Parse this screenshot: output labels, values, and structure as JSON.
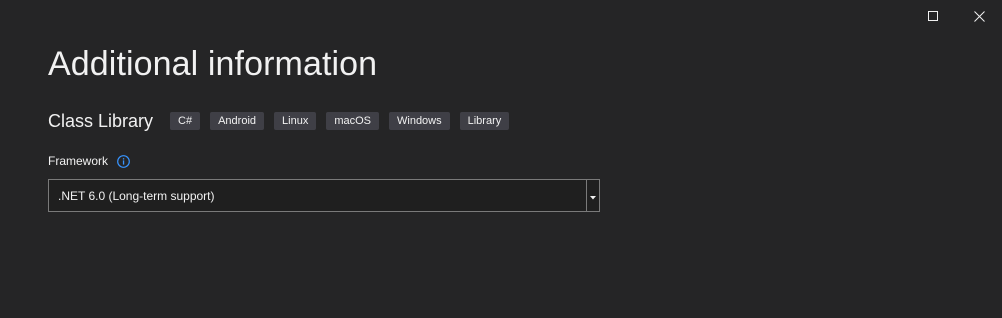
{
  "dialog": {
    "title": "Additional information"
  },
  "window_controls": {
    "maximize_icon": "maximize-icon",
    "close_icon": "close-icon"
  },
  "template": {
    "name": "Class Library",
    "tags": [
      "C#",
      "Android",
      "Linux",
      "macOS",
      "Windows",
      "Library"
    ]
  },
  "framework": {
    "label": "Framework",
    "info_icon": "info-icon",
    "selected": ".NET 6.0 (Long-term support)",
    "dropdown_icon": "caret-down-icon"
  },
  "colors": {
    "background": "#252526",
    "text": "#f1f1f1",
    "tag_background": "#3f3f46",
    "input_border": "#7a7a7a",
    "info_icon": "#3794ff"
  }
}
